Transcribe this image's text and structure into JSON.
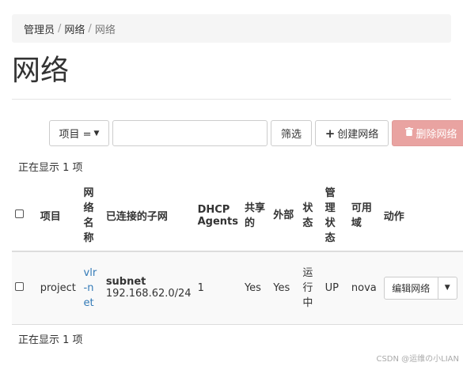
{
  "breadcrumb": {
    "items": [
      "管理员",
      "网络",
      "网络"
    ]
  },
  "page_title": "网络",
  "toolbar": {
    "filter_field": "项目 =",
    "filter_placeholder": "",
    "filter_button": "筛选",
    "create_button": "创建网络",
    "delete_button": "删除网络"
  },
  "count_top": "正在显示 1 项",
  "count_bottom": "正在显示 1 项",
  "table": {
    "headers": {
      "project": "项目",
      "network_name": "网络名称",
      "subnets": "已连接的子网",
      "dhcp_agents": "DHCP Agents",
      "shared": "共享的",
      "external": "外部",
      "status": "状态",
      "admin_state": "管理状态",
      "availability_zones": "可用域",
      "actions": "动作"
    },
    "rows": [
      {
        "project": "project",
        "network_name": "vlr-net",
        "subnet_name": "subnet",
        "subnet_cidr": "192.168.62.0/24",
        "dhcp_agents": "1",
        "shared": "Yes",
        "external": "Yes",
        "status": "运行中",
        "admin_state": "UP",
        "availability_zones": "nova",
        "action_label": "编辑网络"
      }
    ]
  },
  "watermark": "CSDN @运维の小LIAN",
  "colors": {
    "link": "#337ab7",
    "danger_disabled": "#e9a3a1"
  },
  "icons": {
    "create": "plus-icon",
    "delete": "trash-icon",
    "dropdown": "caret-down-icon"
  }
}
